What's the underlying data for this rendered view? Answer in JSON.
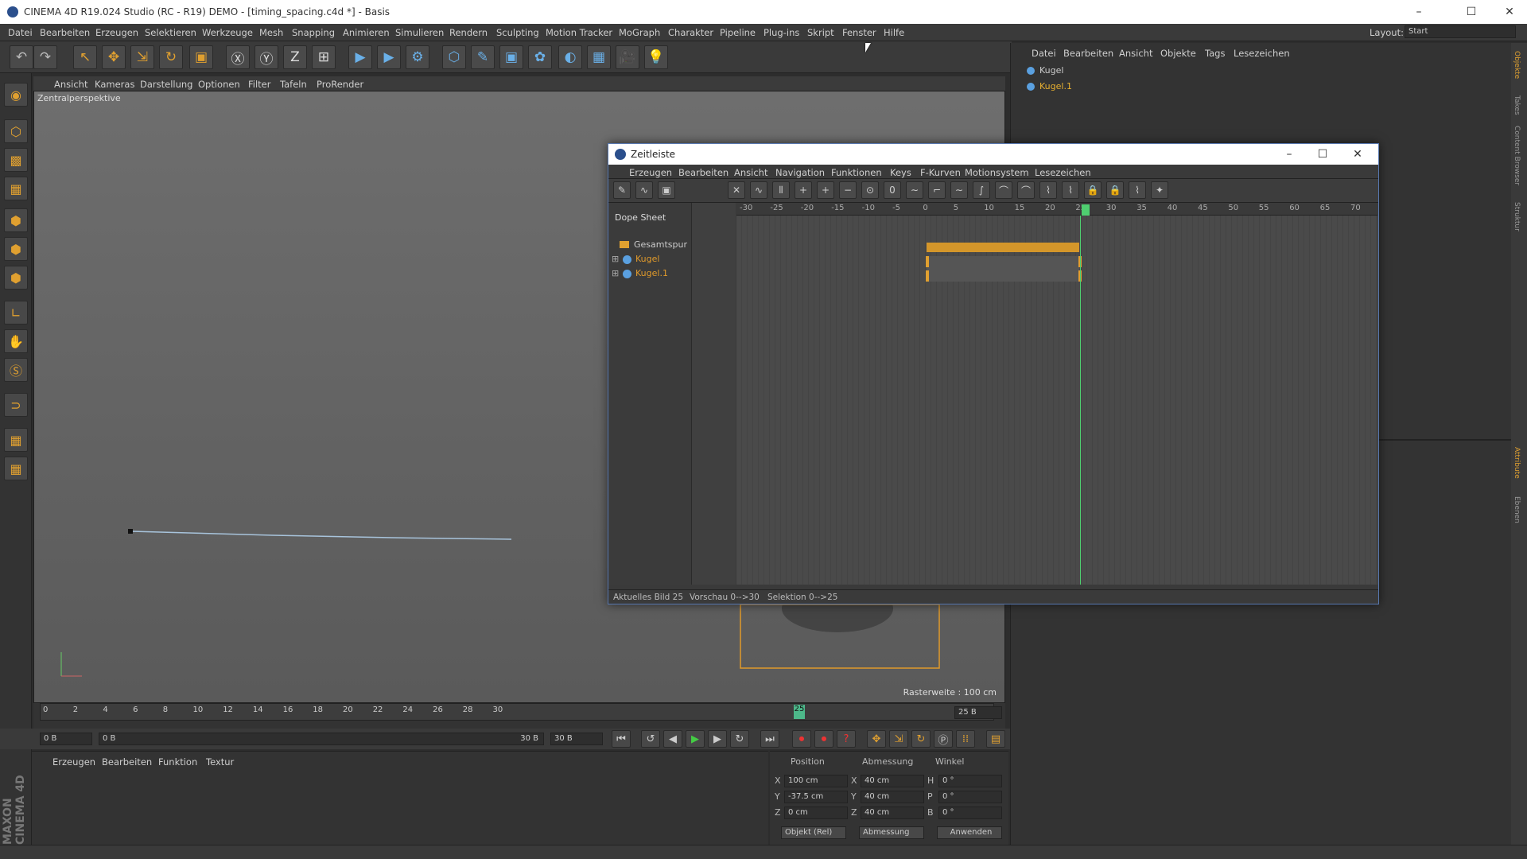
{
  "window": {
    "title": "CINEMA 4D R19.024 Studio (RC - R19) DEMO - [timing_spacing.c4d *] - Basis",
    "minimize": "–",
    "maximize": "☐",
    "close": "✕"
  },
  "menu": [
    "Datei",
    "Bearbeiten",
    "Erzeugen",
    "Selektieren",
    "Werkzeuge",
    "Mesh",
    "Snapping",
    "Animieren",
    "Simulieren",
    "Rendern",
    "Sculpting",
    "Motion Tracker",
    "MoGraph",
    "Charakter",
    "Pipeline",
    "Plug-ins",
    "Skript",
    "Fenster",
    "Hilfe"
  ],
  "layout": {
    "label": "Layout:",
    "value": "Start"
  },
  "toolbar_icons": [
    "undo-icon",
    "redo-icon",
    "select-icon",
    "move-icon",
    "scale-icon",
    "rotate-icon",
    "last-tool-icon",
    "x-axis-icon",
    "y-axis-icon",
    "z-axis-icon",
    "coord-system-icon",
    "render-view-icon",
    "render-picture-icon",
    "render-settings-icon",
    "cube-icon",
    "pen-icon",
    "subdivision-icon",
    "cloner-icon",
    "deformer-icon",
    "floor-icon",
    "camera-icon",
    "light-icon"
  ],
  "toolbar_glyphs": [
    "↶",
    "↷",
    "↖",
    "✥",
    "⇲",
    "↻",
    "▣",
    "Ⓧ",
    "Ⓨ",
    "Z",
    "⊞",
    "▶",
    "▶",
    "⚙",
    "⬡",
    "✎",
    "▣",
    "✿",
    "◐",
    "▦",
    "🎥",
    "💡"
  ],
  "viewport": {
    "menu": [
      "Ansicht",
      "Kameras",
      "Darstellung",
      "Optionen",
      "Filter",
      "Tafeln",
      "ProRender"
    ],
    "label": "Zentralperspektive",
    "grid_spacing": "Rasterweite : 100 cm"
  },
  "timeline": {
    "ticks": [
      "0",
      "2",
      "4",
      "6",
      "8",
      "10",
      "12",
      "14",
      "16",
      "18",
      "20",
      "22",
      "24",
      "26",
      "28",
      "30"
    ],
    "current": "25",
    "end_field": "25 B",
    "start_field": "0 B",
    "range_start": "0 B",
    "range_end": "30 B",
    "max_field": "30 B"
  },
  "object_manager": {
    "menu": [
      "Datei",
      "Bearbeiten",
      "Ansicht",
      "Objekte",
      "Tags",
      "Lesezeichen"
    ],
    "objects": [
      "Kugel",
      "Kugel.1"
    ]
  },
  "material_manager": {
    "menu": [
      "Erzeugen",
      "Bearbeiten",
      "Funktion",
      "Textur"
    ]
  },
  "coordinates": {
    "headers": [
      "Position",
      "Abmessung",
      "Winkel"
    ],
    "rows": [
      {
        "axis": "X",
        "pos": "100 cm",
        "size_axis": "X",
        "size": "40 cm",
        "rot_axis": "H",
        "rot": "0 °"
      },
      {
        "axis": "Y",
        "pos": "-37.5 cm",
        "size_axis": "Y",
        "size": "40 cm",
        "rot_axis": "P",
        "rot": "0 °"
      },
      {
        "axis": "Z",
        "pos": "0 cm",
        "size_axis": "Z",
        "size": "40 cm",
        "rot_axis": "B",
        "rot": "0 °"
      }
    ],
    "mode": "Objekt (Rel)",
    "size_mode": "Abmessung",
    "apply": "Anwenden"
  },
  "right_tabs": [
    "Objekte",
    "Takes",
    "Content Browser",
    "Struktur",
    "Attribute",
    "Ebenen"
  ],
  "zeitleiste": {
    "title": "Zeitleiste",
    "menu": [
      "Erzeugen",
      "Bearbeiten",
      "Ansicht",
      "Navigation",
      "Funktionen",
      "Keys",
      "F-Kurven",
      "Motionsystem",
      "Lesezeichen"
    ],
    "mode": "Dope Sheet",
    "tracks": [
      "Gesamtspur",
      "Kugel",
      "Kugel.1"
    ],
    "ruler": [
      "-30",
      "-25",
      "-20",
      "-15",
      "-10",
      "-5",
      "0",
      "5",
      "10",
      "15",
      "20",
      "25",
      "30",
      "35",
      "40",
      "45",
      "50",
      "55",
      "60",
      "65",
      "70"
    ],
    "status": {
      "current": "Aktuelles Bild  25",
      "preview": "Vorschau  0-->30",
      "selection": "Selektion 0-->25"
    }
  },
  "brand": "MAXON CINEMA 4D"
}
